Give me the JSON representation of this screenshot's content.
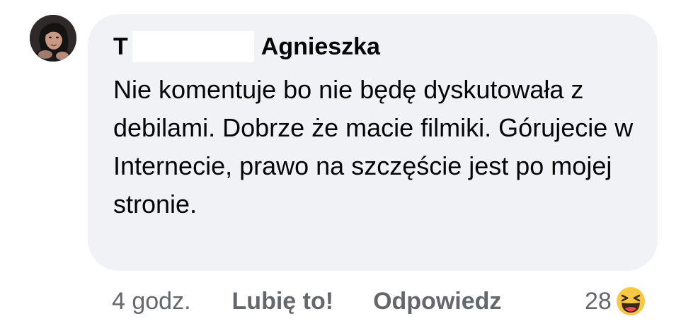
{
  "comment": {
    "author_initial": "T",
    "author_surname": "Agnieszka",
    "text": "Nie komentuje bo nie będę dyskutowała z debilami. Dobrze że macie filmiki. Górujecie w Internecie, prawo na szczęście jest po mojej stronie."
  },
  "actions": {
    "time": "4 godz.",
    "like_label": "Lubię to!",
    "reply_label": "Odpowiedz"
  },
  "reactions": {
    "count": "28",
    "icon": "haha-emoji-icon"
  },
  "colors": {
    "bubble_bg": "#f0f2f5",
    "text": "#050505",
    "secondary_text": "#65676b",
    "emoji_yellow": "#f7c843"
  }
}
